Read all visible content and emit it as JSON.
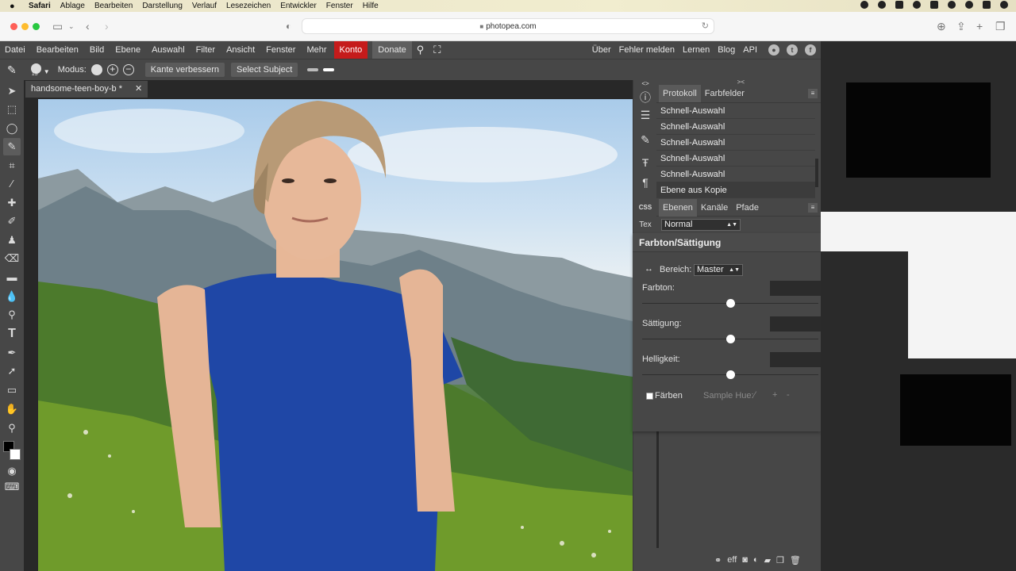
{
  "mac_menubar": {
    "apple": "",
    "items": [
      "Safari",
      "Ablage",
      "Bearbeiten",
      "Darstellung",
      "Verlauf",
      "Lesezeichen",
      "Entwickler",
      "Fenster",
      "Hilfe"
    ]
  },
  "safari": {
    "url": "photopea.com"
  },
  "menubar": {
    "items": [
      "Datei",
      "Bearbeiten",
      "Bild",
      "Ebene",
      "Auswahl",
      "Filter",
      "Ansicht",
      "Fenster",
      "Mehr"
    ],
    "konto": "Konto",
    "donate": "Donate",
    "right_items": [
      "Über",
      "Fehler melden",
      "Lernen",
      "Blog",
      "API"
    ]
  },
  "options": {
    "modus_label": "Modus:",
    "brush_size": "15",
    "refine_edge": "Kante verbessern",
    "select_subject": "Select Subject"
  },
  "document": {
    "tab_title": "handsome-teen-boy-b",
    "tab_modified": "*",
    "close": "✕"
  },
  "iconcol": {
    "css_label": "CSS",
    "tex_label": "Tex"
  },
  "history_panel": {
    "tabs": [
      "Protokoll",
      "Farbfelder"
    ],
    "entries": [
      "Schnell-Auswahl",
      "Schnell-Auswahl",
      "Schnell-Auswahl",
      "Schnell-Auswahl",
      "Schnell-Auswahl",
      "Ebene aus Kopie"
    ]
  },
  "layers_panel": {
    "tabs": [
      "Ebenen",
      "Kanäle",
      "Pfade"
    ],
    "blend_mode": "Normal"
  },
  "adjustment": {
    "title": "Farbton/Sättigung",
    "range_label": "Bereich:",
    "range_value": "Master",
    "hue_label": "Farbton:",
    "saturation_label": "Sättigung:",
    "lightness_label": "Helligkeit:",
    "hue": 0,
    "saturation": 0,
    "lightness": 0,
    "colorize_label": "Färben",
    "sample_hue_label": "Sample Hue:"
  },
  "colors": {
    "konto_bg": "#c51b1b",
    "panel_bg": "#474747",
    "canvas_bg": "#282828"
  }
}
